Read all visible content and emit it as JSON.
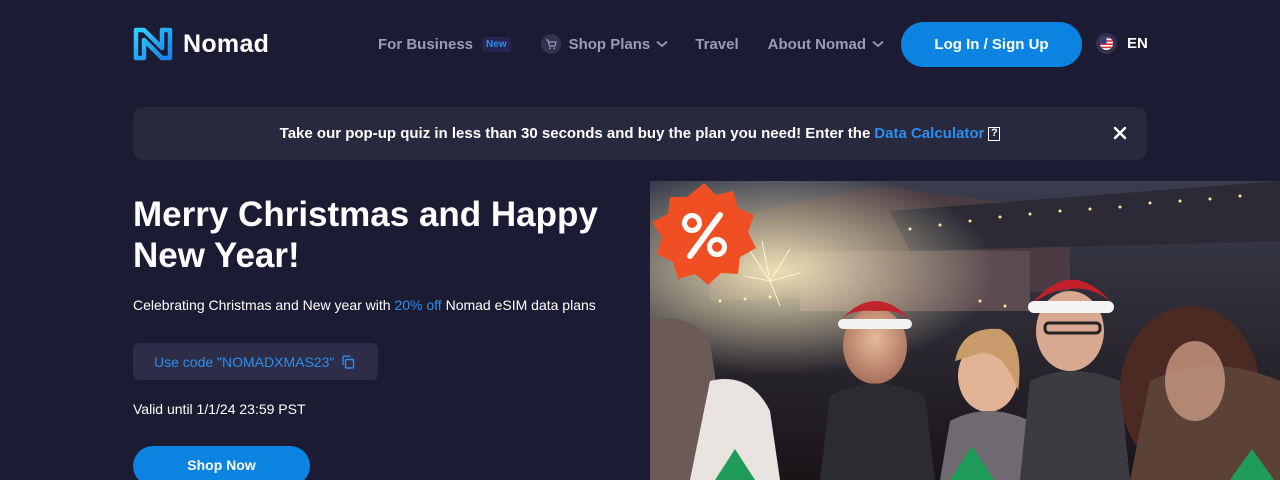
{
  "brand": {
    "name": "Nomad"
  },
  "nav": {
    "business": "For Business",
    "business_badge": "New",
    "shop_plans": "Shop Plans",
    "travel": "Travel",
    "about": "About Nomad"
  },
  "header": {
    "login": "Log In / Sign Up",
    "language": "EN"
  },
  "banner": {
    "text": "Take our pop-up quiz in less than 30 seconds and buy the plan you need! Enter the",
    "link": "Data Calculator",
    "help_glyph": "?"
  },
  "hero": {
    "title": "Merry Christmas and Happy New Year!",
    "subtitle_before": "Celebrating Christmas and New year with ",
    "subtitle_highlight": "20% off",
    "subtitle_after": " Nomad eSIM data plans",
    "code_label": "Use code \"NOMADXMAS23\"",
    "valid_text": "Valid until 1/1/24 23:59 PST",
    "cta": "Shop Now"
  },
  "colors": {
    "background": "#1b1b34",
    "accent": "#0a84e0",
    "link": "#2b8ff0",
    "badge": "#f04e23"
  },
  "icons": {
    "logo": "nomad-logo-icon",
    "cart": "cart-icon",
    "chevron": "chevron-down-icon",
    "flag": "us-flag-icon",
    "close": "close-icon",
    "copy": "copy-icon",
    "percent": "percent-badge-icon"
  }
}
